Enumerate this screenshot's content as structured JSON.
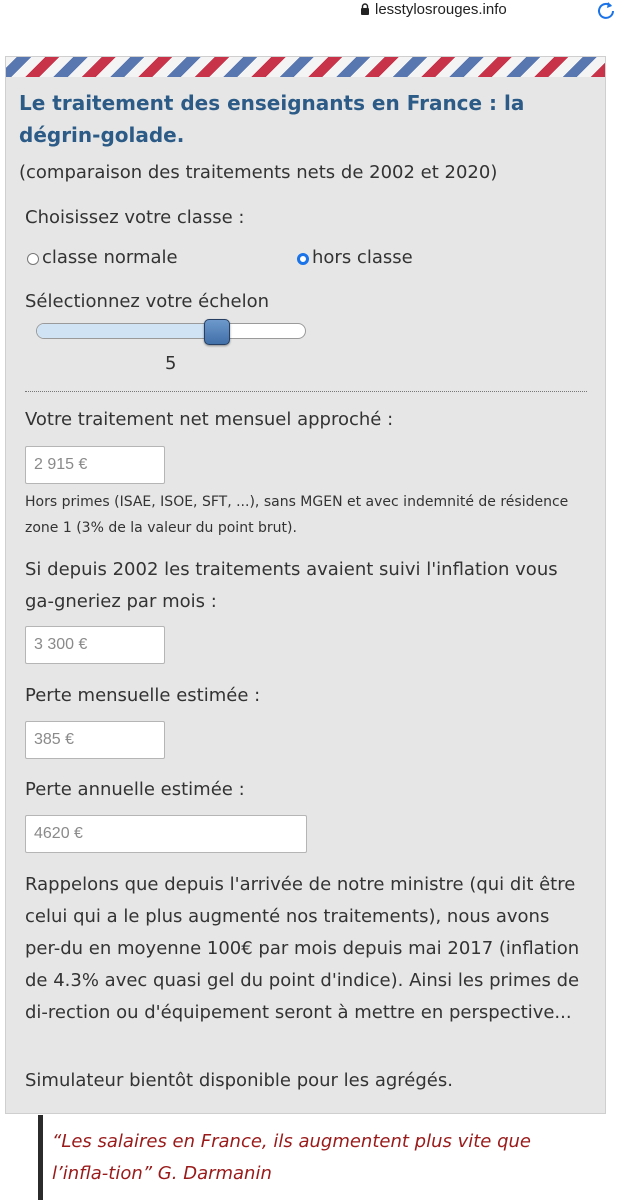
{
  "browser": {
    "url": "lesstylosrouges.info"
  },
  "calculator": {
    "title": "Le traitement des enseignants en France : la dégrin-golade.",
    "subtitle": "(comparaison des traitements nets de 2002 et 2020)",
    "class_label": "Choisissez votre classe :",
    "class_options": [
      {
        "label": "classe normale",
        "checked": false
      },
      {
        "label": "hors classe",
        "checked": true
      }
    ],
    "echelon_label": "Sélectionnez votre échelon",
    "echelon": {
      "value": "5",
      "slider_fraction": 0.67
    },
    "net_label": "Votre traitement net mensuel approché :",
    "net_value": "2 915 €",
    "net_note": "Hors primes (ISAE, ISOE, SFT, ...), sans MGEN et avec indemnité de résidence zone 1 (3% de la valeur du point brut).",
    "inflation_label": "Si depuis 2002 les traitements avaient suivi l'inflation vous ga-gneriez par mois :",
    "inflation_value": "3 300 €",
    "monthly_loss_label": "Perte mensuelle estimée :",
    "monthly_loss_value": "385 €",
    "annual_loss_label": "Perte annuelle estimée :",
    "annual_loss_value": "4620 €",
    "paragraph": "Rappelons que depuis l'arrivée de notre ministre (qui dit être celui qui a le plus augmenté nos traitements), nous avons per-du en moyenne 100€ par mois depuis mai 2017 (inflation de 4.3% avec quasi gel du point d'indice). Ainsi les primes de di-rection ou d'équipement seront à mettre en perspective...",
    "footer_note": "Simulateur bientôt disponible pour les agrégés."
  },
  "quote": {
    "text": "“Les salaires en France, ils augmentent plus vite que l’infla-tion” G. Darmanin"
  },
  "colors": {
    "title": "#2b5b86",
    "card_bg": "#e6e6e6",
    "quote_text": "#9a1a1a",
    "radio_checked": "#1a73e8"
  }
}
